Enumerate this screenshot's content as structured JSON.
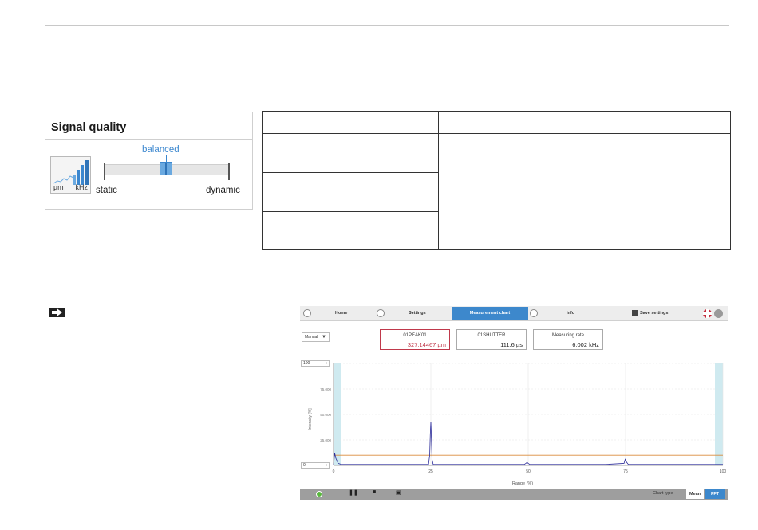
{
  "signal_quality": {
    "title": "Signal quality",
    "icon": "signal-bars-icon",
    "icon_unit_left": "µm",
    "icon_unit_right": "kHz",
    "balanced_label": "balanced",
    "static_label": "static",
    "dynamic_label": "dynamic",
    "level": 0.5
  },
  "app": {
    "nav": {
      "home": "Home",
      "settings": "Settings",
      "measurement_chart": "Measurement chart",
      "info": "Info",
      "save_settings": "Save settings"
    },
    "mode_select": "Manual",
    "readouts": {
      "peak_label": "01PEAK01",
      "peak_value": "327.14467 µm",
      "shutter_label": "01SHUTTER",
      "shutter_value": "111.6 µs",
      "rate_label": "Measuring rate",
      "rate_value": "6.002 kHz"
    },
    "axis_max_input": "100",
    "axis_min_input": "0",
    "bottom_bar": {
      "chart_type_label": "Chart type",
      "mean_label": "Mean",
      "fft_label": "FFT"
    },
    "colors": {
      "accent": "#3d88cc",
      "peak_value": "#c0394b",
      "signal": "#2b2b9a",
      "threshold": "#d98b3a",
      "play": "#59b83e"
    }
  },
  "chart_data": {
    "type": "line",
    "xlabel": "Range (%)",
    "ylabel": "Intensity [%]",
    "xlim": [
      0,
      100
    ],
    "ylim": [
      0,
      100
    ],
    "x_ticks": [
      "0",
      "25",
      "50",
      "75",
      "100"
    ],
    "y_ticks": [
      "100",
      "75.000",
      "50.000",
      "25.000",
      "0"
    ],
    "grid": true,
    "threshold": 10,
    "series": [
      {
        "color": "#2b2b9a",
        "x": [
          0,
          0.3,
          0.6,
          1.2,
          2,
          5,
          10,
          15,
          20,
          24.4,
          24.7,
          24.85,
          25.0,
          25.15,
          25.3,
          25.6,
          30,
          40,
          49,
          49.4,
          49.7,
          50,
          50.4,
          51,
          60,
          70,
          74.6,
          74.9,
          75.3,
          75.7,
          80,
          90,
          99,
          99.5,
          100
        ],
        "values": [
          0,
          12,
          7,
          2,
          1,
          1,
          1,
          1,
          1,
          1,
          10,
          30,
          43,
          26,
          6,
          1,
          1,
          1,
          1,
          2,
          3,
          2,
          1,
          1,
          1,
          1,
          2,
          6,
          3,
          1,
          1,
          1,
          1,
          1,
          1
        ]
      }
    ]
  }
}
